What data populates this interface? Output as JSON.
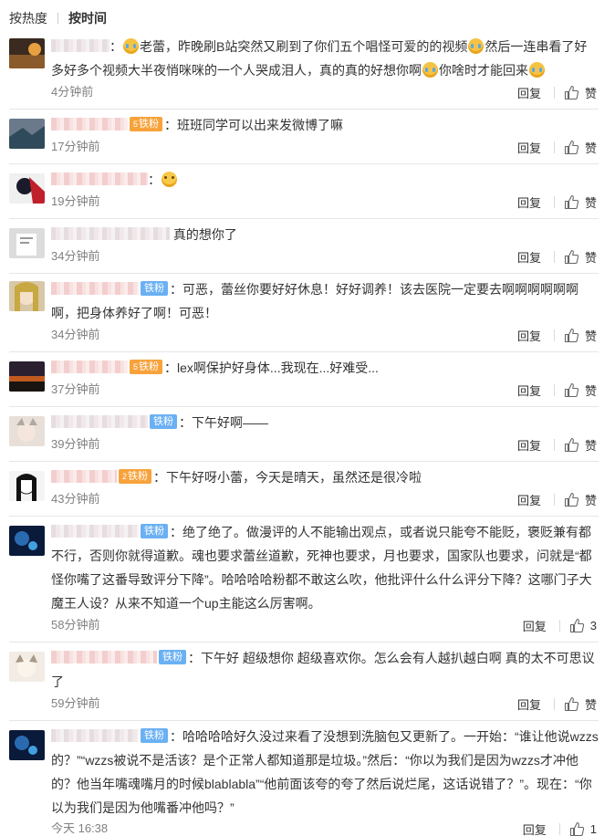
{
  "sort": {
    "hot": "按热度",
    "time": "按时间"
  },
  "actions": {
    "reply": "回复",
    "like": "赞"
  },
  "comments": [
    {
      "text1": "老蕾，昨晚刷B站突然又刷到了你们五个唱怪可爱的的视频",
      "text2": "然后一连串看了好多好多个视频大半夜悄咪咪的一个人哭成泪人，真的真的好想你啊",
      "text3": "你啥时才能回来",
      "time": "4分钟前"
    },
    {
      "badge": "铁粉",
      "badge_level": "5",
      "text1": "班班同学可以出来发微博了嘛",
      "time": "17分钟前"
    },
    {
      "time": "19分钟前"
    },
    {
      "text1": "真的想你了",
      "time": "34分钟前"
    },
    {
      "badge": "铁粉",
      "text1": "可恶，蕾丝你要好好休息！好好调养！该去医院一定要去啊啊啊啊啊啊啊，把身体养好了啊！可恶！",
      "time": "34分钟前"
    },
    {
      "badge": "铁粉",
      "badge_level": "5",
      "text1": "lex啊保护好身体...我现在...好难受...",
      "time": "37分钟前"
    },
    {
      "badge": "铁粉",
      "text1": "下午好啊——",
      "time": "39分钟前"
    },
    {
      "badge": "铁粉",
      "badge_level": "2",
      "text1": "下午好呀小蕾，今天是晴天，虽然还是很冷啦",
      "time": "43分钟前"
    },
    {
      "badge": "铁粉",
      "text1": "绝了绝了。做漫评的人不能输出观点，或者说只能夸不能贬，褒贬兼有都不行，否则你就得道歉。魂也要求蕾丝道歉，死神也要求，月也要求，国家队也要求，问就是“都怪你嘴了这番导致评分下降”。哈哈哈哈粉都不敢这么吹，他批评什么什么评分下降？这哪门子大魔王人设？从来不知道一个up主能这么厉害啊。",
      "time": "58分钟前",
      "likes": "3"
    },
    {
      "badge": "铁粉",
      "text1": "下午好   超级想你   超级喜欢你。怎么会有人越扒越白啊   真的太不可思议了",
      "time": "59分钟前"
    },
    {
      "badge": "铁粉",
      "text1": "哈哈哈哈好久没过来看了没想到洗脑包又更新了。一开始：“谁让他说wzzs的？”“wzzs被说不是活该？是个正常人都知道那是垃圾。”然后：“你以为我们是因为wzzs才冲他的？他当年嘴魂嘴月的时候blablabla”“他前面该夸的夸了然后说烂尾，这话说错了？”。现在：“你以为我们是因为他嘴番冲他吗？”",
      "time": "今天 16:38",
      "likes": "1"
    }
  ]
}
